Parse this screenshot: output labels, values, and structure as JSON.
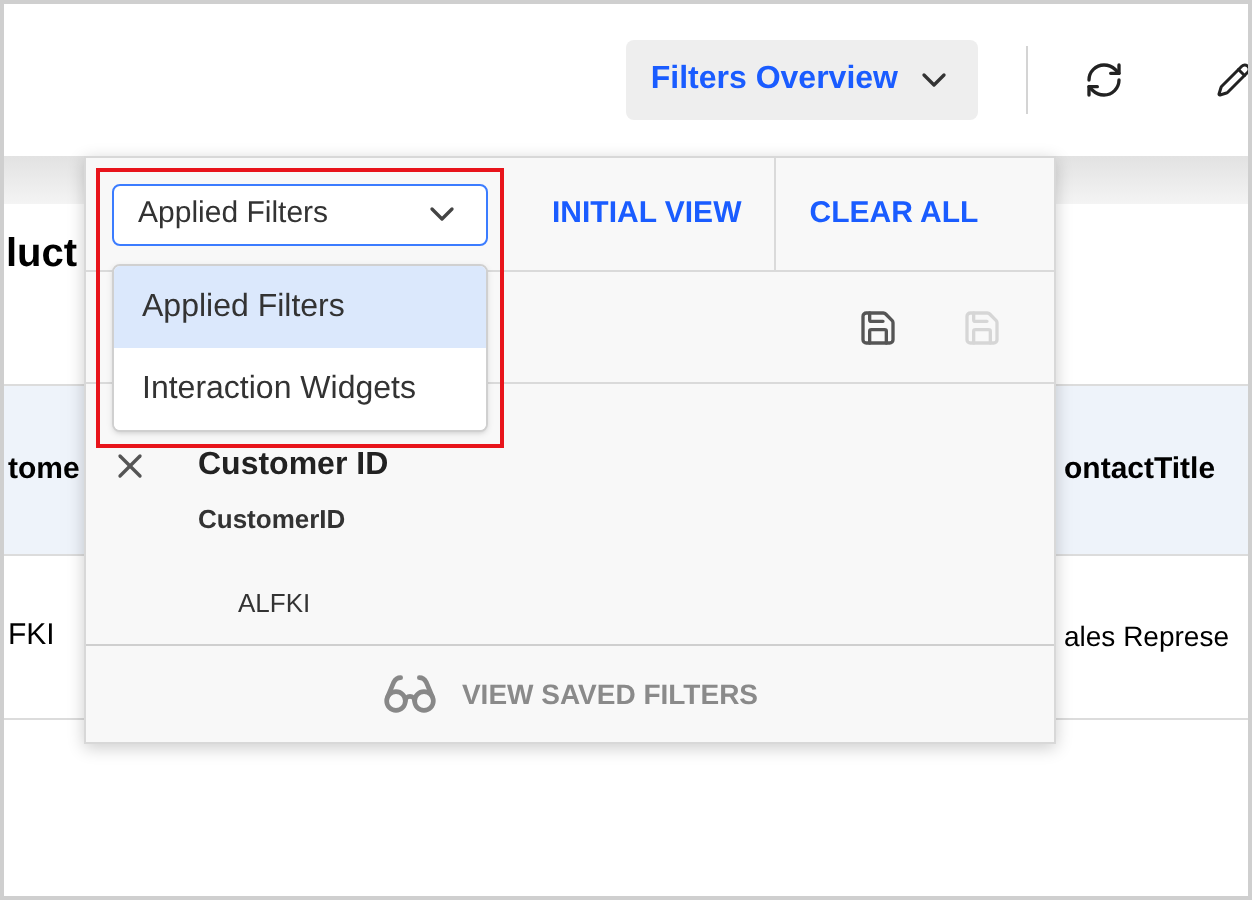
{
  "toolbar": {
    "view_button": "Filters Overview"
  },
  "page": {
    "title": "luct",
    "table": {
      "columns": [
        "tome",
        "ontactTitle"
      ],
      "rows": [
        [
          "FKI",
          "ales Represe"
        ]
      ]
    }
  },
  "filter_panel": {
    "view_select": {
      "value": "Applied Filters",
      "expanded": true,
      "options": [
        {
          "label": "Applied Filters",
          "selected": true
        },
        {
          "label": "Interaction Widgets",
          "selected": false
        }
      ]
    },
    "actions": [
      "INITIAL VIEW",
      "CLEAR ALL"
    ],
    "save_disabled": false,
    "save_as_disabled": true,
    "filter": {
      "field": "Customer ID",
      "column": "CustomerID",
      "values": [
        "ALFKI"
      ]
    },
    "footer_link": "VIEW SAVED FILTERS"
  },
  "highlight": true
}
